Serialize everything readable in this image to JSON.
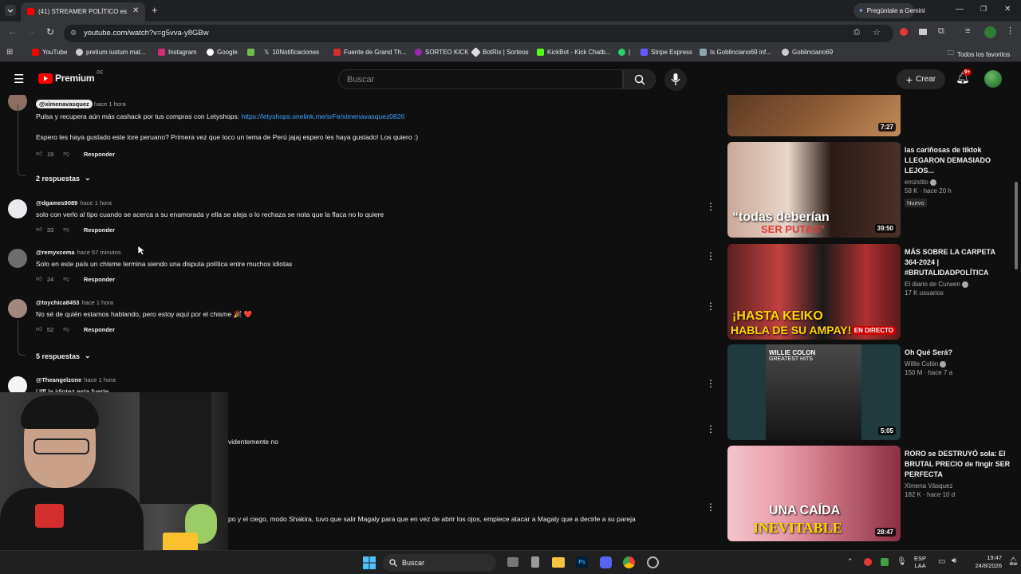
{
  "browser": {
    "tab_title": "(41) STREAMER POLÍTICO es El",
    "url": "youtube.com/watch?v=g5vva-y8GBw",
    "gemini_label": "Pregúntale a Gemini",
    "bookmarks": [
      "YouTube",
      "pretium iustum mat...",
      "Instagram",
      "Google",
      "10Notificaciones",
      "Fuente de Grand Th...",
      "SORTEO KICK",
      "BotRix | Sorteos",
      "KickBot - Kick Chatb...",
      "|",
      "Stripe Express",
      "Is Goblinciano69 inf...",
      "Goblinciano69"
    ],
    "all_bookmarks": "Todos los favoritos"
  },
  "header": {
    "logo": "Premium",
    "logo_region": "PE",
    "search_placeholder": "Buscar",
    "create_label": "Crear",
    "notif_count": "9+"
  },
  "comments": {
    "first": {
      "author": "@ximenavasquez",
      "time": "hace 1 hora",
      "line1_prefix": "Pulsa y recupera aún más cashack por tus compras con Letyshops:",
      "line1_link": "https://letyshops.onelink.me/srFe/ximenavasquez0826",
      "line2": "Espero les haya gustado este lore peruano? Primera vez que toco un tema de Perú jajaj espero les haya gustado! Los quiero :)",
      "likes": "19",
      "reply": "Responder"
    },
    "replies_1": "2 respuestas",
    "items": [
      {
        "author": "@dgames9089",
        "time": "hace 1 hora",
        "text": "solo con verlo al tipo cuando se acerca a su enamorada y ella se aleja o lo rechaza se nota que la flaca no lo quiere",
        "likes": "33",
        "reply": "Responder"
      },
      {
        "author": "@remyxcema",
        "time": "hace 57 minutos",
        "text": "Solo en este país un chisme termina siendo una disputa política entre muchos idiotas",
        "likes": "24",
        "reply": "Responder"
      },
      {
        "author": "@toychica8453",
        "time": "hace 1 hora",
        "text": "No sé de quién estamos hablando, pero estoy aquí por el chisme 🎉 ❤️",
        "likes": "52",
        "reply": "Responder"
      }
    ],
    "replies_2": "5 respuestas",
    "partial": {
      "author": "@Theangelzone",
      "time": "hace 1 hora",
      "text": "Ufff la idiotez esta fuerte",
      "fragment_1": "videntemente no",
      "fragment_2": "po y el ciego, modo Shakira, tuvo que salir Magaly para que en vez de abrir los ojos, empiece atacar a Magaly que a decirle a su pareja"
    }
  },
  "sidebar": {
    "videos": [
      {
        "title": "",
        "channel": "",
        "views": "",
        "age": "",
        "duration": "7:27",
        "thumb_color": "#7a4a2a"
      },
      {
        "title": "las cariñosas de tiktok LLEGARON DEMASIADO LEJOS...",
        "channel": "emzstito",
        "views": "58 K",
        "age": "hace 20 h",
        "badge": "Nuevo",
        "duration": "39:50",
        "thumb_text": "“todas deberían",
        "thumb_text2": "SER PUTAS”",
        "thumb_color": "#5a4038"
      },
      {
        "title": "MÁS SOBRE LA CARPETA 364-2024 | #BRUTALIDADPOLÍTICA",
        "channel": "El diario de Curwen",
        "views": "17 K usuarios",
        "age": "",
        "duration": "EN DIRECTO",
        "thumb_text": "¡HASTA KEIKO",
        "thumb_text2": "HABLA DE SU AMPAY!",
        "thumb_color": "#8a2a2a"
      },
      {
        "title": "Oh Qué Será?",
        "channel": "Willie Colón",
        "views": "150 M",
        "age": "hace 7 a",
        "duration": "5:05",
        "thumb_text": "WILLIE COLON",
        "thumb_text2": "GREATEST HITS",
        "thumb_color": "#1e3a3e"
      },
      {
        "title": "RORO se DESTRUYÓ sola: El BRUTAL PRECIO de fingir SER PERFECTA",
        "channel": "Ximena Vásquez",
        "views": "182 K",
        "age": "hace 10 d",
        "duration": "28:47",
        "thumb_text": "UNA CAÍDA",
        "thumb_text2": "INEVITABLE",
        "thumb_color": "#6a2a3a"
      }
    ]
  },
  "taskbar": {
    "search_label": "Buscar",
    "lang_top": "ESP",
    "lang_bottom": "LAA",
    "time": "19:47",
    "date": "24/8/2026"
  }
}
